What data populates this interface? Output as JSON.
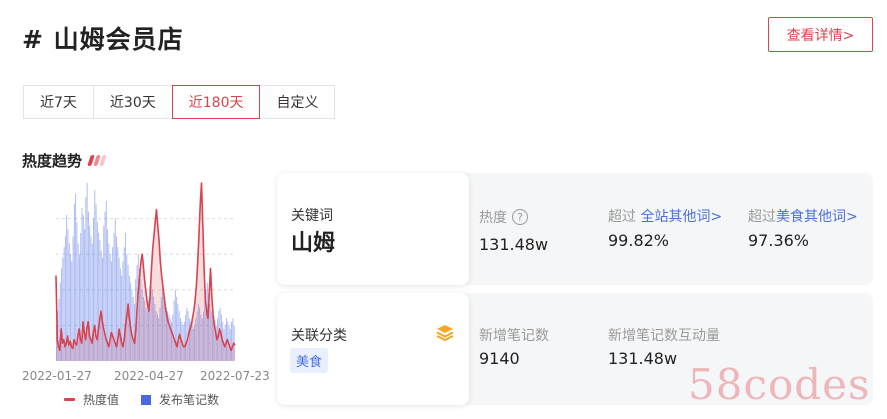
{
  "header": {
    "title": "# 山姆会员店",
    "detail_button": "查看详情>"
  },
  "tabs": [
    {
      "label": "近7天",
      "active": false
    },
    {
      "label": "近30天",
      "active": false
    },
    {
      "label": "近180天",
      "active": true
    },
    {
      "label": "自定义",
      "active": false
    }
  ],
  "section": {
    "title": "热度趋势"
  },
  "colors": {
    "accent_red": "#d9434e",
    "heat_line": "#d9434e",
    "notes_bar": "#5b78e8",
    "link_blue": "#4a6fe0"
  },
  "chart_data": {
    "type": "bar",
    "x_ticks": [
      "2022-01-27",
      "2022-04-27",
      "2022-07-23"
    ],
    "ylim": [
      0,
      100
    ],
    "grid": true,
    "legend_position": "bottom",
    "series": [
      {
        "name": "热度值",
        "type": "line",
        "values": [
          48,
          12,
          8,
          6,
          18,
          10,
          12,
          8,
          10,
          14,
          9,
          11,
          8,
          7,
          12,
          10,
          9,
          14,
          18,
          12,
          10,
          22,
          16,
          12,
          18,
          22,
          14,
          12,
          10,
          16,
          20,
          14,
          12,
          18,
          24,
          28,
          22,
          18,
          15,
          12,
          10,
          8,
          12,
          16,
          14,
          12,
          10,
          8,
          12,
          18,
          14,
          10,
          8,
          12,
          20,
          26,
          32,
          24,
          18,
          14,
          12,
          10,
          18,
          30,
          40,
          48,
          56,
          60,
          52,
          44,
          38,
          32,
          28,
          36,
          50,
          62,
          70,
          78,
          85,
          76,
          68,
          56,
          48,
          42,
          36,
          30,
          26,
          22,
          20,
          18,
          16,
          14,
          12,
          10,
          8,
          12,
          15,
          12,
          10,
          8,
          8,
          10,
          12,
          15,
          18,
          20,
          24,
          28,
          34,
          42,
          55,
          70,
          88,
          100,
          76,
          52,
          34,
          28,
          24,
          38,
          52,
          36,
          26,
          20,
          16,
          12,
          14,
          18,
          16,
          12,
          10,
          8,
          10,
          12,
          10,
          8,
          6,
          8,
          10,
          9
        ]
      },
      {
        "name": "发布笔记数",
        "type": "bar",
        "values": [
          20,
          28,
          35,
          44,
          52,
          58,
          64,
          70,
          82,
          74,
          66,
          60,
          56,
          70,
          88,
          94,
          78,
          66,
          60,
          72,
          86,
          82,
          74,
          92,
          100,
          84,
          76,
          70,
          66,
          80,
          96,
          88,
          78,
          72,
          68,
          62,
          58,
          76,
          84,
          90,
          74,
          66,
          60,
          56,
          64,
          72,
          80,
          70,
          64,
          58,
          52,
          48,
          56,
          64,
          72,
          60,
          54,
          48,
          44,
          40,
          36,
          32,
          46,
          54,
          60,
          52,
          46,
          40,
          36,
          34,
          30,
          28,
          34,
          42,
          48,
          40,
          36,
          32,
          28,
          26,
          24,
          30,
          36,
          42,
          38,
          34,
          30,
          28,
          26,
          24,
          22,
          26,
          34,
          40,
          36,
          32,
          28,
          24,
          22,
          20,
          22,
          26,
          30,
          28,
          24,
          22,
          20,
          18,
          20,
          24,
          28,
          32,
          30,
          26,
          24,
          28,
          34,
          40,
          44,
          38,
          32,
          28,
          26,
          24,
          22,
          20,
          24,
          28,
          30,
          26,
          22,
          18,
          20,
          24,
          22,
          20,
          18,
          22,
          24,
          20
        ]
      }
    ]
  },
  "legend": {
    "heat": "热度值",
    "notes": "发布笔记数"
  },
  "keyword_panel": {
    "label": "关键词",
    "value": "山姆",
    "heat_label": "热度",
    "help_glyph": "?",
    "heat_value": "131.48w",
    "exceed1_prefix": "超过",
    "exceed1_link": "全站其他词>",
    "exceed1_value": "99.82%",
    "exceed2_prefix": "超过",
    "exceed2_link": "美食其他词>",
    "exceed2_value": "97.36%"
  },
  "category_panel": {
    "label": "关联分类",
    "tag": "美食",
    "icon": "layers-icon",
    "new_notes_label": "新增笔记数",
    "new_notes_value": "9140",
    "interactions_label": "新增笔记数互动量",
    "interactions_value": "131.48w"
  },
  "watermark": "58codes"
}
